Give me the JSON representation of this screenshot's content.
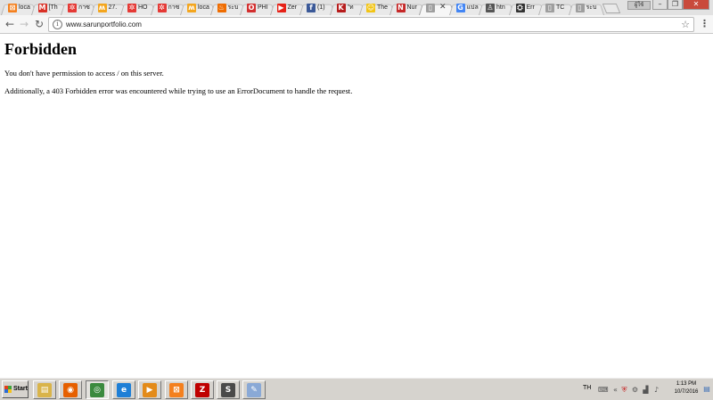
{
  "browser": {
    "tabs": [
      {
        "title": "loca",
        "favicon": "xampp-icon",
        "color": "#f4801e",
        "glyph": "⊠"
      },
      {
        "title": "[Th",
        "favicon": "gmail-icon",
        "color": "#d93025",
        "glyph": "M"
      },
      {
        "title": "กาซ",
        "favicon": "plugin-icon",
        "color": "#e53935",
        "glyph": "✲"
      },
      {
        "title": "27.",
        "favicon": "xampp-small-icon",
        "color": "#f4a61e",
        "glyph": "ʍ"
      },
      {
        "title": "HO",
        "favicon": "plugin-icon",
        "color": "#e53935",
        "glyph": "✲"
      },
      {
        "title": "กาซ",
        "favicon": "plugin-icon",
        "color": "#e53935",
        "glyph": "✲"
      },
      {
        "title": "loca",
        "favicon": "xampp-small-icon",
        "color": "#f4a61e",
        "glyph": "ʍ"
      },
      {
        "title": "ระบ",
        "favicon": "fire-icon",
        "color": "#ef6c00",
        "glyph": "♨"
      },
      {
        "title": "PHI",
        "favicon": "opera-icon",
        "color": "#d32f2f",
        "glyph": "O"
      },
      {
        "title": "Zer",
        "favicon": "youtube-icon",
        "color": "#e62117",
        "glyph": "▶"
      },
      {
        "title": "(1)",
        "favicon": "facebook-icon",
        "color": "#3b5998",
        "glyph": "f"
      },
      {
        "title": "\"ท",
        "favicon": "k-icon",
        "color": "#b71c1c",
        "glyph": "K"
      },
      {
        "title": "The",
        "favicon": "smiley-icon",
        "color": "#f2c414",
        "glyph": "☺"
      },
      {
        "title": "Nur",
        "favicon": "n-icon",
        "color": "#c62828",
        "glyph": "N"
      },
      {
        "title": "",
        "favicon": "document-icon",
        "color": "#9e9e9e",
        "glyph": "▯",
        "active": true
      },
      {
        "title": "แปล",
        "favicon": "google-icon",
        "color": "#4285f4",
        "glyph": "G"
      },
      {
        "title": "htn",
        "favicon": "linux-icon",
        "color": "#555555",
        "glyph": "♙"
      },
      {
        "title": "Err",
        "favicon": "github-icon",
        "color": "#333333",
        "glyph": "⛭"
      },
      {
        "title": "TC",
        "favicon": "document-icon",
        "color": "#9e9e9e",
        "glyph": "▯"
      },
      {
        "title": "ระบ",
        "favicon": "document-icon",
        "color": "#9e9e9e",
        "glyph": "▯"
      }
    ],
    "close_tab_glyph": "✕",
    "window_label": "ผู้ใช้",
    "window_buttons": {
      "minimize": "–",
      "restore": "❐",
      "close": "✕"
    },
    "url": "www.sarunportfolio.com"
  },
  "page": {
    "heading": "Forbidden",
    "line1": "You don't have permission to access / on this server.",
    "line2": "Additionally, a 403 Forbidden error was encountered while trying to use an ErrorDocument to handle the request."
  },
  "taskbar": {
    "start_label": "Start",
    "apps": [
      {
        "name": "file-explorer",
        "color": "#d9b44a",
        "glyph": "▤"
      },
      {
        "name": "firefox",
        "color": "#e66000",
        "glyph": "◉"
      },
      {
        "name": "chrome",
        "color": "#3b8a3e",
        "glyph": "◎",
        "pressed": true
      },
      {
        "name": "internet-explorer",
        "color": "#1f7fd6",
        "glyph": "e"
      },
      {
        "name": "media-player",
        "color": "#e38b1a",
        "glyph": "▶"
      },
      {
        "name": "xampp",
        "color": "#f4801e",
        "glyph": "⊠"
      },
      {
        "name": "filezilla",
        "color": "#bf0000",
        "glyph": "Z"
      },
      {
        "name": "sublime-text",
        "color": "#4a4a4a",
        "glyph": "S"
      },
      {
        "name": "notepad",
        "color": "#8aa9d6",
        "glyph": "✎"
      }
    ],
    "language": "TH",
    "time": "1:13 PM",
    "date": "10/7/2016"
  }
}
